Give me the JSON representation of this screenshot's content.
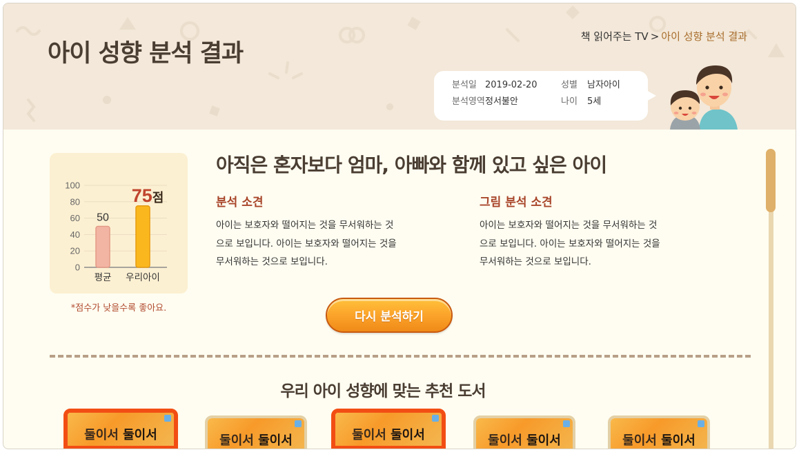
{
  "header": {
    "title": "아이 성향 분석 결과",
    "breadcrumb": {
      "parent": "책 읽어주는 TV",
      "separator": ">",
      "current": "아이 성향 분석 결과"
    },
    "info": {
      "date_label": "분석일",
      "date_value": "2019-02-20",
      "gender_label": "성별",
      "gender_value": "남자아이",
      "area_label": "분석영역",
      "area_value": "정서불안",
      "age_label": "나이",
      "age_value": "5세"
    }
  },
  "score": {
    "note": "*점수가 낮을수록 좋아요.",
    "unit": "점"
  },
  "chart_data": {
    "type": "bar",
    "categories": [
      "평균",
      "우리아이"
    ],
    "values": [
      50,
      75
    ],
    "ylim": [
      0,
      100
    ],
    "yticks": [
      0,
      20,
      40,
      60,
      80,
      100
    ],
    "value_labels": [
      "50",
      "75"
    ],
    "colors": [
      "#f3b5a3",
      "#fbb81e"
    ]
  },
  "result": {
    "headline": "아직은 혼자보다 엄마, 아빠와 함께 있고 싶은 아이",
    "analysis_title": "분석 소견",
    "analysis_lines": [
      "아이는 보호자와 떨어지는 것을 무서워하는 것",
      "으로 보입니다. 아이는 보호자와 떨어지는 것을",
      "무서워하는 것으로 보입니다."
    ],
    "drawing_title": "그림 분석 소견",
    "drawing_lines": [
      "아이는 보호자와 떨어지는 것을 무서워하는 것",
      "으로 보입니다. 아이는 보호자와 떨어지는 것을",
      "무서워하는 것으로 보입니다."
    ],
    "retry_label": "다시 분석하기"
  },
  "recommend": {
    "title": "우리 아이 성향에 맞는 추천 도서",
    "books": [
      {
        "title_a": "둘이서",
        "title_b": "둘이서",
        "selected": true
      },
      {
        "title_a": "둘이서",
        "title_b": "둘이서",
        "selected": false
      },
      {
        "title_a": "둘이서",
        "title_b": "둘이서",
        "selected": true
      },
      {
        "title_a": "둘이서",
        "title_b": "둘이서",
        "selected": false
      },
      {
        "title_a": "둘이서",
        "title_b": "둘이서",
        "selected": false
      }
    ]
  },
  "colors": {
    "accent": "#f08a18",
    "brand_brown": "#4a3d32",
    "header_bg": "#f3e8d9",
    "section_red": "#a8452a"
  }
}
